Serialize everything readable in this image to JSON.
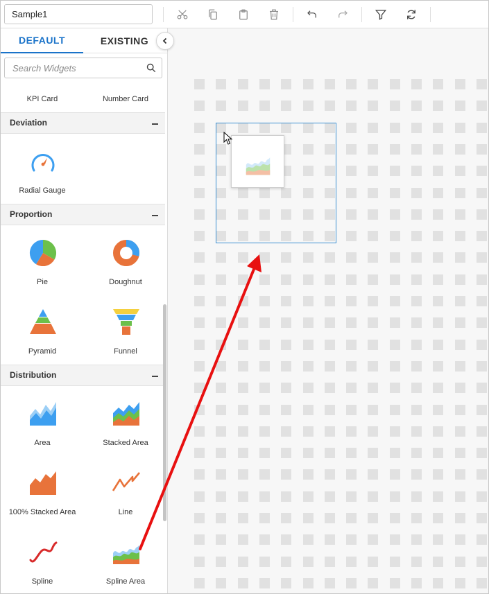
{
  "toolbar": {
    "dashboard_name": "Sample1",
    "icons": [
      "cut-icon",
      "copy-icon",
      "paste-icon",
      "delete-icon",
      "undo-icon",
      "redo-icon",
      "filter-icon",
      "refresh-icon"
    ]
  },
  "sidebar": {
    "tabs": [
      {
        "label": "DEFAULT",
        "active": true
      },
      {
        "label": "EXISTING",
        "active": false
      }
    ],
    "search_placeholder": "Search Widgets",
    "top_widgets": [
      "KPI Card",
      "Number Card"
    ],
    "sections": [
      {
        "title": "Deviation",
        "widgets": [
          "Radial Gauge"
        ]
      },
      {
        "title": "Proportion",
        "widgets": [
          "Pie",
          "Doughnut",
          "Pyramid",
          "Funnel"
        ]
      },
      {
        "title": "Distribution",
        "widgets": [
          "Area",
          "Stacked Area",
          "100% Stacked Area",
          "Line",
          "Spline",
          "Spline Area"
        ]
      }
    ]
  },
  "colors": {
    "accent": "#1a73c9",
    "widget_blue": "#3d9ff0",
    "widget_orange": "#e8733a",
    "widget_green": "#6cc04a",
    "widget_yellow": "#f4d03f",
    "annotation_arrow": "#e81010",
    "drop_zone_border": "#3b8fd0"
  }
}
